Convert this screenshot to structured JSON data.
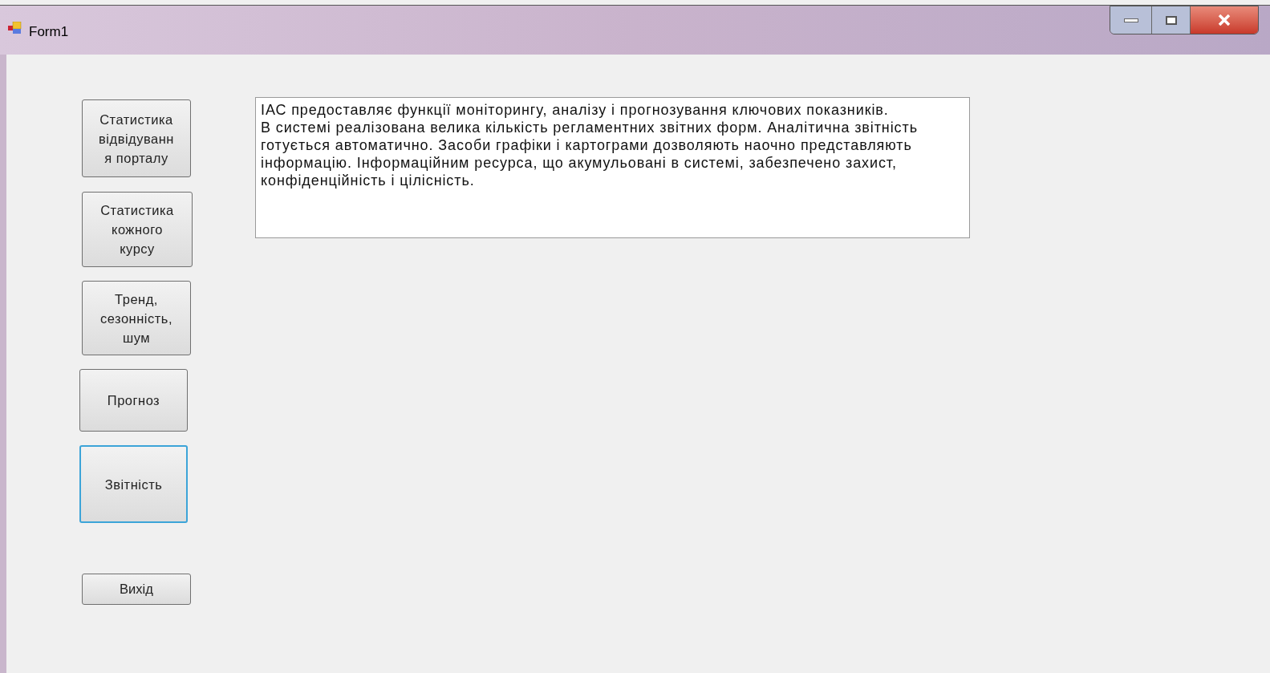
{
  "window": {
    "title": "Form1"
  },
  "nav_buttons": [
    {
      "lines": [
        "Статистика",
        "відвідуванн",
        "я порталу"
      ],
      "selected": false
    },
    {
      "lines": [
        "Статистика",
        "кожного",
        "курсу"
      ],
      "selected": false
    },
    {
      "lines": [
        "Тренд,",
        "сезонність,",
        "шум"
      ],
      "selected": false
    },
    {
      "lines": [
        "Прогноз"
      ],
      "selected": false
    },
    {
      "lines": [
        "Звітність"
      ],
      "selected": true
    }
  ],
  "exit_button": {
    "label": "Вихід"
  },
  "text_box": {
    "lines": [
      "ІАС предоставляє функції моніторингу, аналізу і прогнозування ключових показників.",
      "В системі реалізована велика кількість регламентних звітних форм. Аналітична звітність",
      "готується автоматично. Засоби графіки і картограми дозволяють наочно представляють",
      "інформацію. Інформаційним ресурса, що акумульовані в системі, забезпечено захист,",
      "конфіденційність і цілісність."
    ]
  }
}
